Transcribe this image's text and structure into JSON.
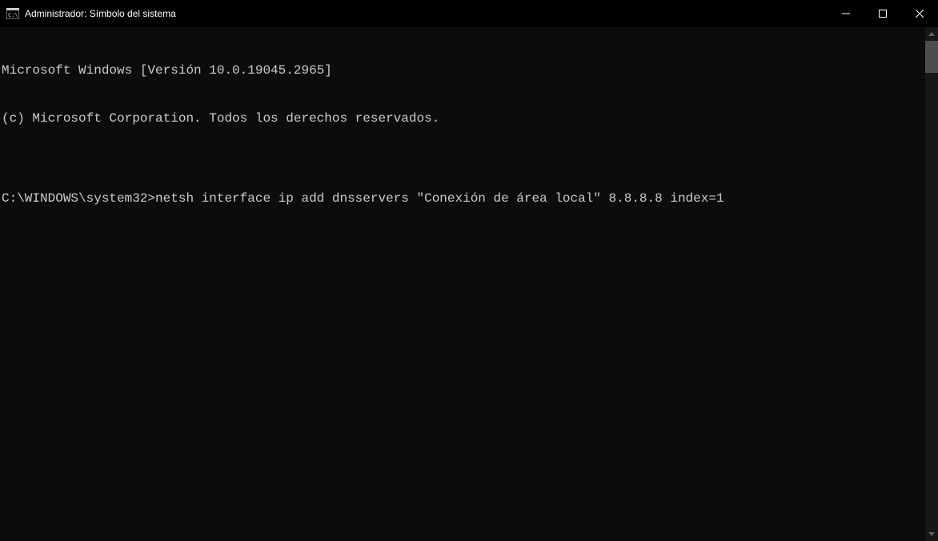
{
  "titlebar": {
    "title": "Administrador: Símbolo del sistema"
  },
  "console": {
    "line1": "Microsoft Windows [Versión 10.0.19045.2965]",
    "line2": "(c) Microsoft Corporation. Todos los derechos reservados.",
    "blank": "",
    "prompt": "C:\\WINDOWS\\system32>",
    "command": "netsh interface ip add dnsservers \"Conexión de área local\" 8.8.8.8 index=1"
  }
}
